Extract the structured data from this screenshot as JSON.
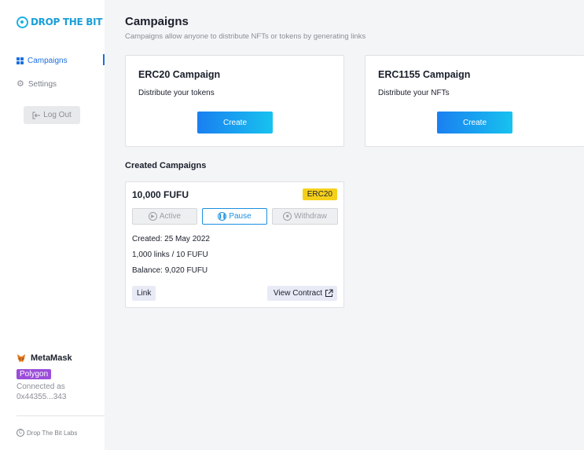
{
  "app": {
    "logo_text": "DROP THE BIT"
  },
  "sidebar": {
    "items": [
      {
        "label": "Campaigns",
        "icon": "grid-icon",
        "active": true
      },
      {
        "label": "Settings",
        "icon": "gear-icon",
        "active": false
      }
    ],
    "logout_label": "Log Out",
    "wallet": {
      "name": "MetaMask",
      "network": "Polygon",
      "connected_label": "Connected as",
      "address": "0x44355...343"
    },
    "footer": "Drop The Bit Labs"
  },
  "header": {
    "title": "Campaigns",
    "subtitle": "Campaigns allow anyone to distribute NFTs or tokens by generating links"
  },
  "campaign_types": [
    {
      "title": "ERC20 Campaign",
      "description": "Distribute your tokens",
      "button_label": "Create"
    },
    {
      "title": "ERC1155 Campaign",
      "description": "Distribute your NFTs",
      "button_label": "Create"
    }
  ],
  "created": {
    "section_title": "Created Campaigns",
    "campaigns": [
      {
        "amount": "10,000 FUFU",
        "type": "ERC20",
        "actions": {
          "active": "Active",
          "pause": "Pause",
          "withdraw": "Withdraw"
        },
        "created": "Created: 25 May 2022",
        "links": "1,000 links / 10 FUFU",
        "balance": "Balance: 9,020 FUFU",
        "link_label": "Link",
        "contract_label": "View Contract"
      }
    ]
  },
  "colors": {
    "accent": "#1b6fe0",
    "brand": "#1a9fd8",
    "badge_yellow": "#f5d01a",
    "network_purple": "#9b4dd9"
  }
}
